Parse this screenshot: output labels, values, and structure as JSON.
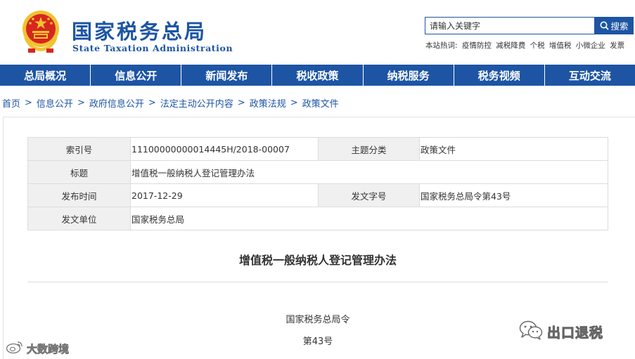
{
  "header": {
    "title": "国家税务总局",
    "subtitle": "State Taxation Administration",
    "search_placeholder": "请输入关键字",
    "search_button_label": "搜索",
    "hot_words_label": "本站热词:",
    "hot_words": [
      "疫情防控",
      "减税降费",
      "个税",
      "增值税",
      "小微企业",
      "发票"
    ]
  },
  "nav": {
    "items": [
      "总局概况",
      "信息公开",
      "新闻发布",
      "税收政策",
      "纳税服务",
      "税务视频",
      "互动交流"
    ]
  },
  "breadcrumb": {
    "items": [
      "首页",
      "信息公开",
      "政府信息公开",
      "法定主动公开内容",
      "政策法规",
      "政策文件"
    ],
    "separator": ">"
  },
  "meta": {
    "index_label": "索引号",
    "index_value": "11100000000014445H/2018-00007",
    "topic_label": "主题分类",
    "topic_value": "政策文件",
    "title_label": "标题",
    "title_value": "增值税一般纳税人登记管理办法",
    "date_label": "发布时间",
    "date_value": "2017-12-29",
    "doc_no_label": "发文字号",
    "doc_no_value": "国家税务总局令第43号",
    "issuer_label": "发文单位",
    "issuer_value": "国家税务总局"
  },
  "document": {
    "title": "增值税一般纳税人登记管理办法",
    "issuer_line": "国家税务总局令",
    "number_line": "第43号"
  },
  "watermarks": {
    "right_text": "出口退税",
    "left_text": "大数跨境"
  },
  "colors": {
    "brand_blue": "#1d55a4",
    "emblem_red": "#d7261e",
    "emblem_gold": "#f2c230"
  }
}
